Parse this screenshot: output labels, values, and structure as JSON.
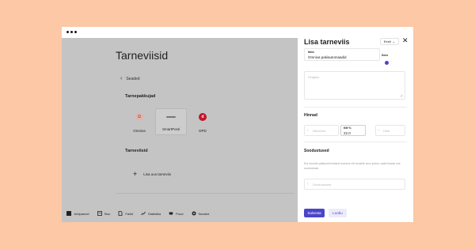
{
  "main": {
    "title": "Tarneviisid",
    "back_label": "Seaded",
    "section_packages": "Tarnepakkujad",
    "providers": [
      {
        "name": "Omniva",
        "logo_text": "Ω"
      },
      {
        "name": "SmartPosti",
        "logo_text": ""
      },
      {
        "name": "DPD",
        "logo_text": "d"
      }
    ],
    "section_methods": "Tarneviisid",
    "add_label": "Lisa uus tarneviis"
  },
  "bottom_nav": [
    {
      "label": "Juhtpaneel",
      "icon": "dashboard-icon"
    },
    {
      "label": "Sisu",
      "icon": "content-icon"
    },
    {
      "label": "Failid",
      "icon": "files-icon"
    },
    {
      "label": "Statistika",
      "icon": "stats-icon"
    },
    {
      "label": "Pood",
      "icon": "shop-icon"
    },
    {
      "label": "Seaded",
      "icon": "settings-icon"
    }
  ],
  "panel": {
    "title": "Lisa tarneviis",
    "language": "Eesti",
    "name_label": "Nimi",
    "name_value": "Omniva pakiautomaadid",
    "on_label": "Sees",
    "description_placeholder": "Selgitus",
    "prices_heading": "Hinnad",
    "price_placeholder": "Netohind",
    "vat_label": "KM %",
    "vat_value": "22.0",
    "gross_placeholder": "Hind",
    "discounts_heading": "Soodustused",
    "discounts_help": "Kui soovite pakkumisi teatud summa või toodete arvu puhul, saab lisada uue soodustuse.",
    "discount_placeholder": "Soodustused",
    "save_label": "Salvesta",
    "cancel_label": "Loobu"
  },
  "colors": {
    "background": "#FCC8A6",
    "accent": "#4A45C9",
    "overlay": "#C4C4C4"
  }
}
